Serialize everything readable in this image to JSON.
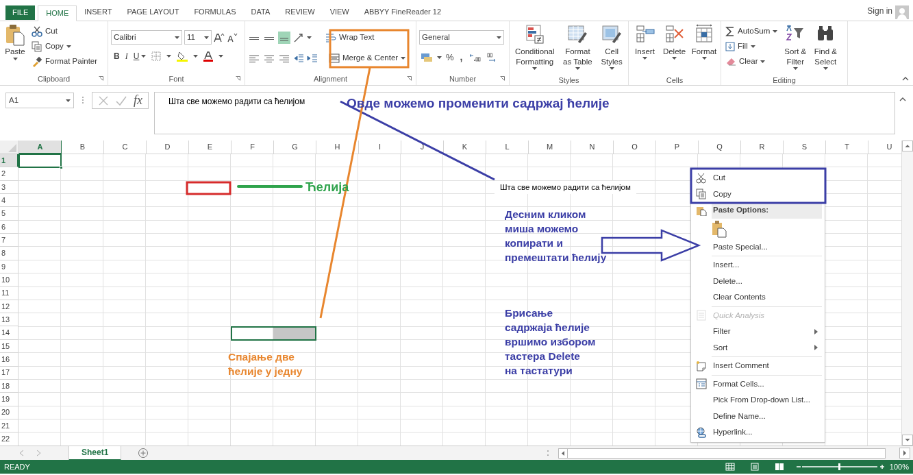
{
  "ribbon_tabs": [
    {
      "label": "FILE",
      "kind": "file",
      "selected": false
    },
    {
      "label": "HOME",
      "kind": "tab",
      "selected": true
    },
    {
      "label": "INSERT",
      "kind": "tab",
      "selected": false
    },
    {
      "label": "PAGE LAYOUT",
      "kind": "tab",
      "selected": false
    },
    {
      "label": "FORMULAS",
      "kind": "tab",
      "selected": false
    },
    {
      "label": "DATA",
      "kind": "tab",
      "selected": false
    },
    {
      "label": "REVIEW",
      "kind": "tab",
      "selected": false
    },
    {
      "label": "VIEW",
      "kind": "tab",
      "selected": false
    },
    {
      "label": "ABBYY FineReader 12",
      "kind": "tab",
      "selected": false
    }
  ],
  "sign_in": "Sign in",
  "ribbon": {
    "clipboard": {
      "paste": "Paste",
      "cut": "Cut",
      "copy": "Copy",
      "format_painter": "Format Painter",
      "label": "Clipboard"
    },
    "font": {
      "font_name": "Calibri",
      "font_size": "11",
      "bold": "B",
      "italic": "I",
      "underline": "U",
      "label": "Font"
    },
    "alignment": {
      "wrap_text": "Wrap Text",
      "merge_center": "Merge & Center",
      "label": "Alignment"
    },
    "number": {
      "format": "General",
      "percent": "%",
      "comma": ",",
      "label": "Number"
    },
    "styles": {
      "buttons": [
        "Conditional Formatting",
        "Format as Table",
        "Cell Styles"
      ],
      "label": "Styles"
    },
    "cells": {
      "buttons": [
        "Insert",
        "Delete",
        "Format"
      ],
      "label": "Cells"
    },
    "editing": {
      "autosum": "AutoSum",
      "fill": "Fill",
      "clear": "Clear",
      "sort_filter": "Sort & Filter",
      "find_select": "Find & Select",
      "label": "Editing"
    }
  },
  "formula_bar": {
    "name_box": "A1",
    "fx": "fx",
    "content": "Шта све можемо радити са ћелијом"
  },
  "sheet": {
    "columns": [
      {
        "label": "A",
        "selected": true
      },
      {
        "label": "B",
        "selected": false
      },
      {
        "label": "C",
        "selected": false
      },
      {
        "label": "D",
        "selected": false
      },
      {
        "label": "E",
        "selected": false
      },
      {
        "label": "F",
        "selected": false
      },
      {
        "label": "G",
        "selected": false
      },
      {
        "label": "H",
        "selected": false
      },
      {
        "label": "I",
        "selected": false
      },
      {
        "label": "J",
        "selected": false
      },
      {
        "label": "K",
        "selected": false
      },
      {
        "label": "L",
        "selected": false
      },
      {
        "label": "M",
        "selected": false
      },
      {
        "label": "N",
        "selected": false
      },
      {
        "label": "O",
        "selected": false
      },
      {
        "label": "P",
        "selected": false
      },
      {
        "label": "Q",
        "selected": false
      },
      {
        "label": "R",
        "selected": false
      },
      {
        "label": "S",
        "selected": false
      },
      {
        "label": "T",
        "selected": false
      },
      {
        "label": "U",
        "selected": false
      }
    ],
    "rows": [
      {
        "label": "1",
        "selected": true
      },
      {
        "label": "2",
        "selected": false
      },
      {
        "label": "3",
        "selected": false
      },
      {
        "label": "4",
        "selected": false
      },
      {
        "label": "5",
        "selected": false
      },
      {
        "label": "6",
        "selected": false
      },
      {
        "label": "7",
        "selected": false
      },
      {
        "label": "8",
        "selected": false
      },
      {
        "label": "9",
        "selected": false
      },
      {
        "label": "10",
        "selected": false
      },
      {
        "label": "11",
        "selected": false
      },
      {
        "label": "12",
        "selected": false
      },
      {
        "label": "13",
        "selected": false
      },
      {
        "label": "14",
        "selected": false
      },
      {
        "label": "15",
        "selected": false
      },
      {
        "label": "16",
        "selected": false
      },
      {
        "label": "17",
        "selected": false
      },
      {
        "label": "18",
        "selected": false
      },
      {
        "label": "19",
        "selected": false
      },
      {
        "label": "20",
        "selected": false
      },
      {
        "label": "21",
        "selected": false
      },
      {
        "label": "22",
        "selected": false
      }
    ],
    "cell_text": "Шта све можемо радити са ћелијом"
  },
  "annotations": [
    {
      "text": "Овде можемо променити садржај ћелије",
      "color": "#3b3ea6"
    },
    {
      "text": "Ћелија",
      "color": "#2fa34c"
    },
    {
      "text": "Десним кликом миша можемо копирати и премештати ћелију",
      "color": "#3b3ea6"
    },
    {
      "text": "Спајање две\nћелије у једну",
      "color": "#e8862e"
    },
    {
      "text": "Брисање\nсадржаја ћелије\nвршимо избором\nтастера Delete\nна тастатури",
      "color": "#3b3ea6"
    }
  ],
  "context_menu": [
    {
      "label": "Cut",
      "kind": "item",
      "disabled": false,
      "submenu": false
    },
    {
      "label": "Copy",
      "kind": "item",
      "disabled": false,
      "submenu": false
    },
    {
      "label": "Paste Options:",
      "kind": "header"
    },
    {
      "kind": "paste_icon"
    },
    {
      "label": "Paste Special...",
      "kind": "item",
      "disabled": false,
      "submenu": false
    },
    {
      "kind": "separator"
    },
    {
      "label": "Insert...",
      "kind": "item",
      "disabled": false,
      "submenu": false
    },
    {
      "label": "Delete...",
      "kind": "item",
      "disabled": false,
      "submenu": false
    },
    {
      "label": "Clear Contents",
      "kind": "item",
      "disabled": false,
      "submenu": false
    },
    {
      "kind": "separator"
    },
    {
      "label": "Quick Analysis",
      "kind": "item",
      "disabled": true,
      "submenu": false
    },
    {
      "label": "Filter",
      "kind": "item",
      "disabled": false,
      "submenu": true
    },
    {
      "label": "Sort",
      "kind": "item",
      "disabled": false,
      "submenu": true
    },
    {
      "kind": "separator"
    },
    {
      "label": "Insert Comment",
      "kind": "item",
      "disabled": false,
      "submenu": false
    },
    {
      "kind": "separator"
    },
    {
      "label": "Format Cells...",
      "kind": "item",
      "disabled": false,
      "submenu": false
    },
    {
      "label": "Pick From Drop-down List...",
      "kind": "item",
      "disabled": false,
      "submenu": false
    },
    {
      "label": "Define Name...",
      "kind": "item",
      "disabled": false,
      "submenu": false
    },
    {
      "label": "Hyperlink...",
      "kind": "item",
      "disabled": false,
      "submenu": false
    }
  ],
  "sheet_tabs": [
    {
      "label": "Sheet1",
      "selected": true
    }
  ],
  "status_bar": {
    "status": "READY",
    "zoom": "100%"
  }
}
